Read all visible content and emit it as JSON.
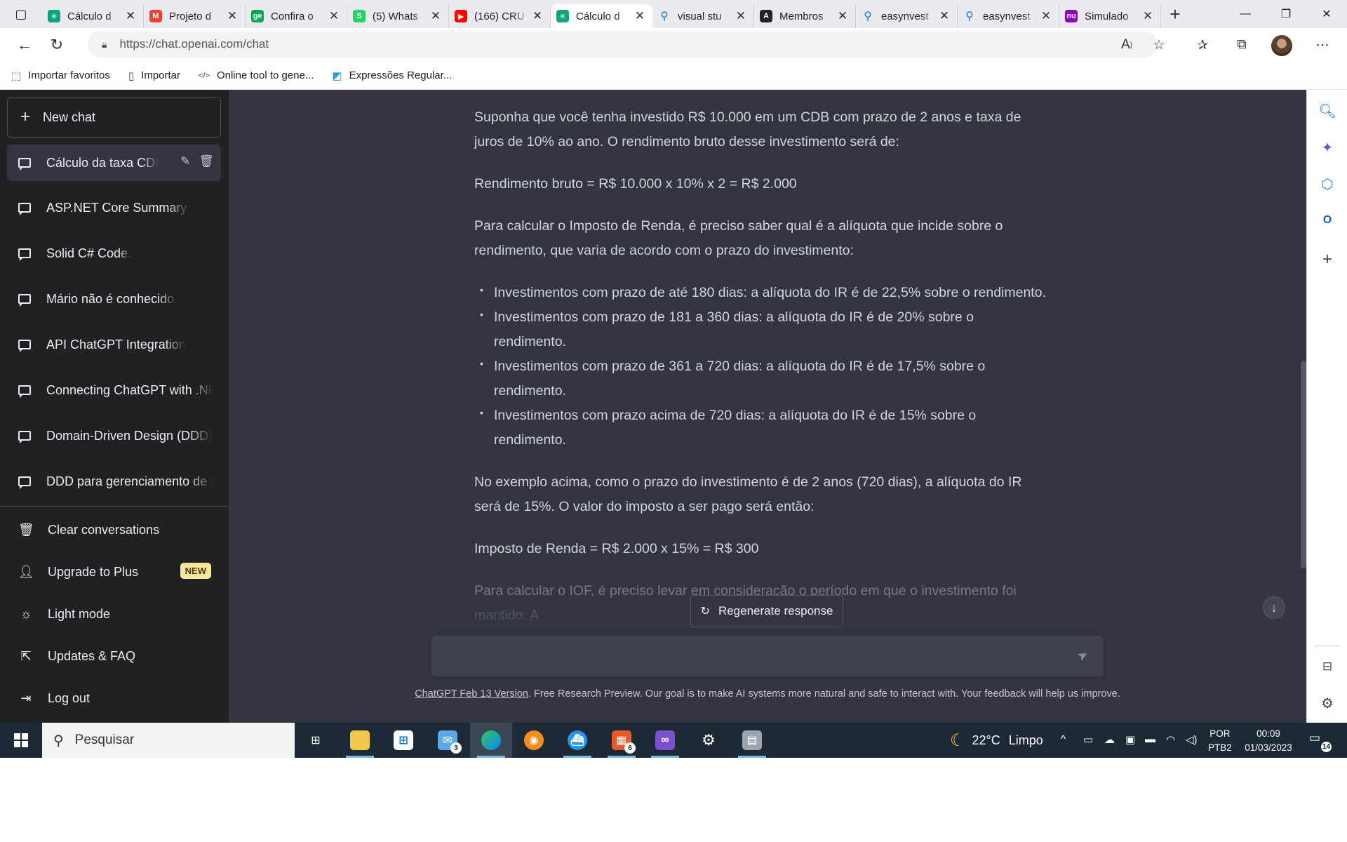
{
  "browser": {
    "tabs": [
      {
        "title": "Cálculo d",
        "icon": "chatgpt-icon",
        "color": "#10a37f"
      },
      {
        "title": "Projeto d",
        "icon": "gmail-icon",
        "color": "#ea4335"
      },
      {
        "title": "Confira o",
        "icon": "ge-icon",
        "color": "#0aa653"
      },
      {
        "title": "(5) Whats",
        "icon": "whatsapp-icon",
        "color": "#25d366"
      },
      {
        "title": "(166) CRU",
        "icon": "youtube-icon",
        "color": "#ff0000"
      },
      {
        "title": "Cálculo d",
        "icon": "chatgpt-icon",
        "color": "#10a37f",
        "active": true
      },
      {
        "title": "visual stu",
        "icon": "search-icon",
        "color": "#1a73e8"
      },
      {
        "title": "Membros",
        "icon": "angular-icon",
        "color": "#222222"
      },
      {
        "title": "easynvest",
        "icon": "search-icon",
        "color": "#1a73e8"
      },
      {
        "title": "easynvest",
        "icon": "search-icon",
        "color": "#1a73e8"
      },
      {
        "title": "Simulado",
        "icon": "nubank-icon",
        "color": "#8a05be"
      }
    ],
    "url": "https://chat.openai.com/chat",
    "bookmarks": [
      {
        "label": "Importar favoritos",
        "icon": "import-favorites-icon"
      },
      {
        "label": "Importar",
        "icon": "page-icon"
      },
      {
        "label": "Online tool to gene...",
        "icon": "code-icon"
      },
      {
        "label": "Expressões Regular...",
        "icon": "regex-icon"
      }
    ],
    "fav_glyphs": {
      "gmail": "M",
      "ge": "ge",
      "whatsapp": "S",
      "youtube": "▶",
      "nubank": "nu",
      "angular": "A"
    }
  },
  "sidebar": {
    "new_chat": "New chat",
    "conversations": [
      "Cálculo da taxa CDI",
      "ASP.NET Core Summary.",
      "Solid C# Code.",
      "Mário não é conhecido.",
      "API ChatGPT Integration",
      "Connecting ChatGPT with .NET",
      "Domain-Driven Design (DDD)",
      "DDD para gerenciamento de banco"
    ],
    "clear": "Clear conversations",
    "upgrade": "Upgrade to Plus",
    "upgrade_badge": "NEW",
    "light_mode": "Light mode",
    "updates": "Updates & FAQ",
    "logout": "Log out"
  },
  "message": {
    "p1": "Suponha que você tenha investido R$ 10.000 em um CDB com prazo de 2 anos e taxa de juros de 10% ao ano. O rendimento bruto desse investimento será de:",
    "p2": "Rendimento bruto = R$ 10.000 x 10% x 2 = R$ 2.000",
    "p3": "Para calcular o Imposto de Renda, é preciso saber qual é a alíquota que incide sobre o rendimento, que varia de acordo com o prazo do investimento:",
    "bullets": [
      "Investimentos com prazo de até 180 dias: a alíquota do IR é de 22,5% sobre o rendimento.",
      "Investimentos com prazo de 181 a 360 dias: a alíquota do IR é de 20% sobre o rendimento.",
      "Investimentos com prazo de 361 a 720 dias: a alíquota do IR é de 17,5% sobre o rendimento.",
      "Investimentos com prazo acima de 720 dias: a alíquota do IR é de 15% sobre o rendimento."
    ],
    "p4": "No exemplo acima, como o prazo do investimento é de 2 anos (720 dias), a alíquota do IR será de 15%. O valor do imposto a ser pago será então:",
    "p5": "Imposto de Renda = R$ 2.000 x 15% = R$ 300",
    "p6": "Para calcular o IOF, é preciso levar em consideração o período em que o investimento foi mantido. A"
  },
  "chat": {
    "regenerate": "Regenerate response",
    "footer_link": "ChatGPT Feb 13 Version",
    "footer_text": ". Free Research Preview. Our goal is to make AI systems more natural and safe to interact with. Your feedback will help us improve."
  },
  "taskbar": {
    "search_placeholder": "Pesquisar",
    "mail_count": "3",
    "office_count": "6",
    "weather_temp": "22°C",
    "weather_desc": "Limpo",
    "lang_top": "POR",
    "lang_bottom": "PTB2",
    "time": "00:09",
    "date": "01/03/2023",
    "notifications": "14"
  }
}
